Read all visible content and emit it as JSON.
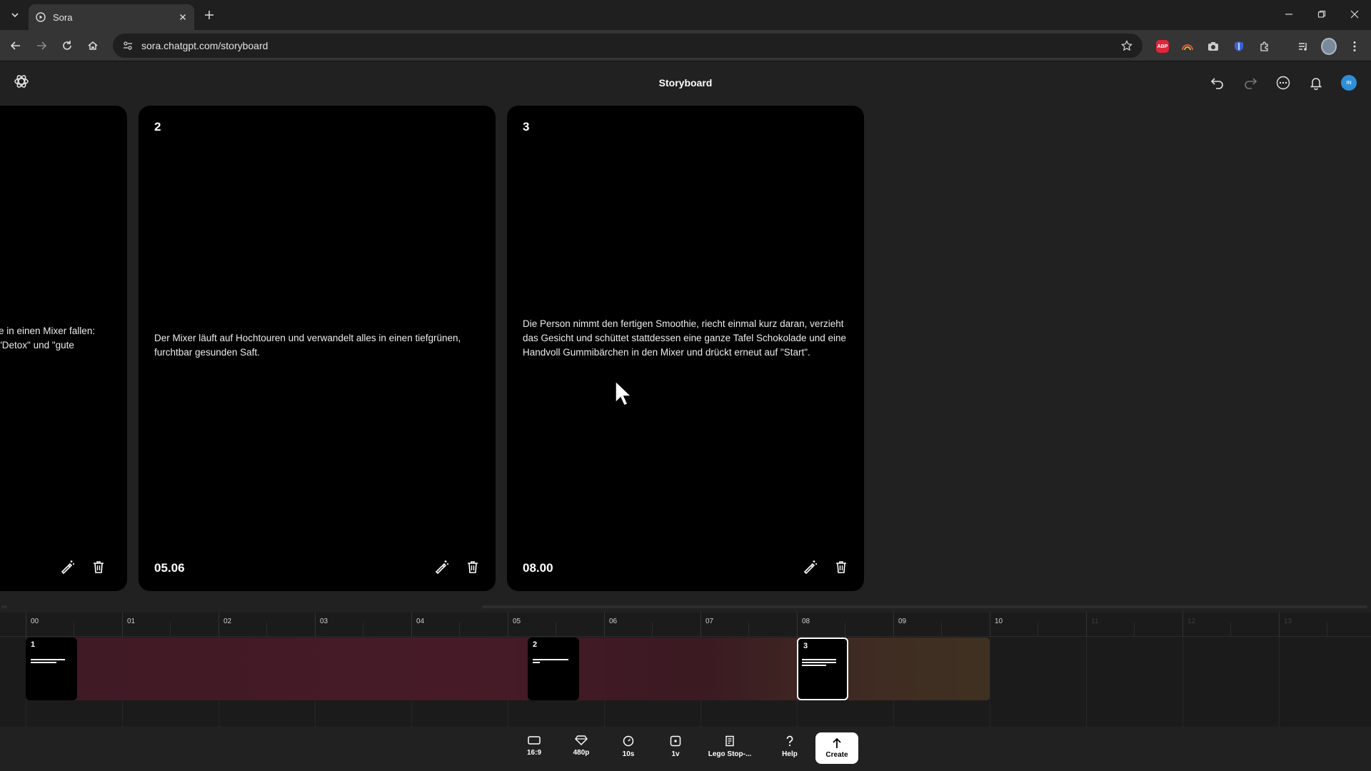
{
  "browser": {
    "tab_title": "Sora",
    "url": "sora.chatgpt.com/storyboard"
  },
  "header": {
    "title": "Storyboard",
    "avatar_initials": "IN"
  },
  "cards": [
    {
      "num": "",
      "text": "e in einen Mixer fallen: \"Detox\" und \"gute",
      "time": ""
    },
    {
      "num": "2",
      "text": "Der Mixer läuft auf Hochtouren und verwandelt alles in einen tiefgrünen, furchtbar gesunden Saft.",
      "time": "05.06"
    },
    {
      "num": "3",
      "text": "Die Person nimmt den fertigen Smoothie, riecht einmal kurz daran, verzieht das Gesicht und schüttet stattdessen eine ganze Tafel Schokolade und eine Handvoll Gummibärchen in den Mixer und drückt erneut auf \"Start\".",
      "time": "08.00"
    }
  ],
  "timeline": {
    "ticks": [
      "00",
      "01",
      "02",
      "03",
      "04",
      "05",
      "06",
      "07",
      "08",
      "09",
      "10",
      "11",
      "12",
      "13"
    ],
    "clips": [
      {
        "num": "1"
      },
      {
        "num": "2"
      },
      {
        "num": "3"
      }
    ]
  },
  "controls": {
    "aspect": "16:9",
    "resolution": "480p",
    "duration": "10s",
    "variations": "1v",
    "preset": "Lego Stop-...",
    "help": "Help",
    "create": "Create"
  },
  "colors": {
    "accent_avatar": "#2f8fd6",
    "abp": "#e0263a",
    "track_start": "#461b27",
    "track_end": "#3f3122"
  }
}
